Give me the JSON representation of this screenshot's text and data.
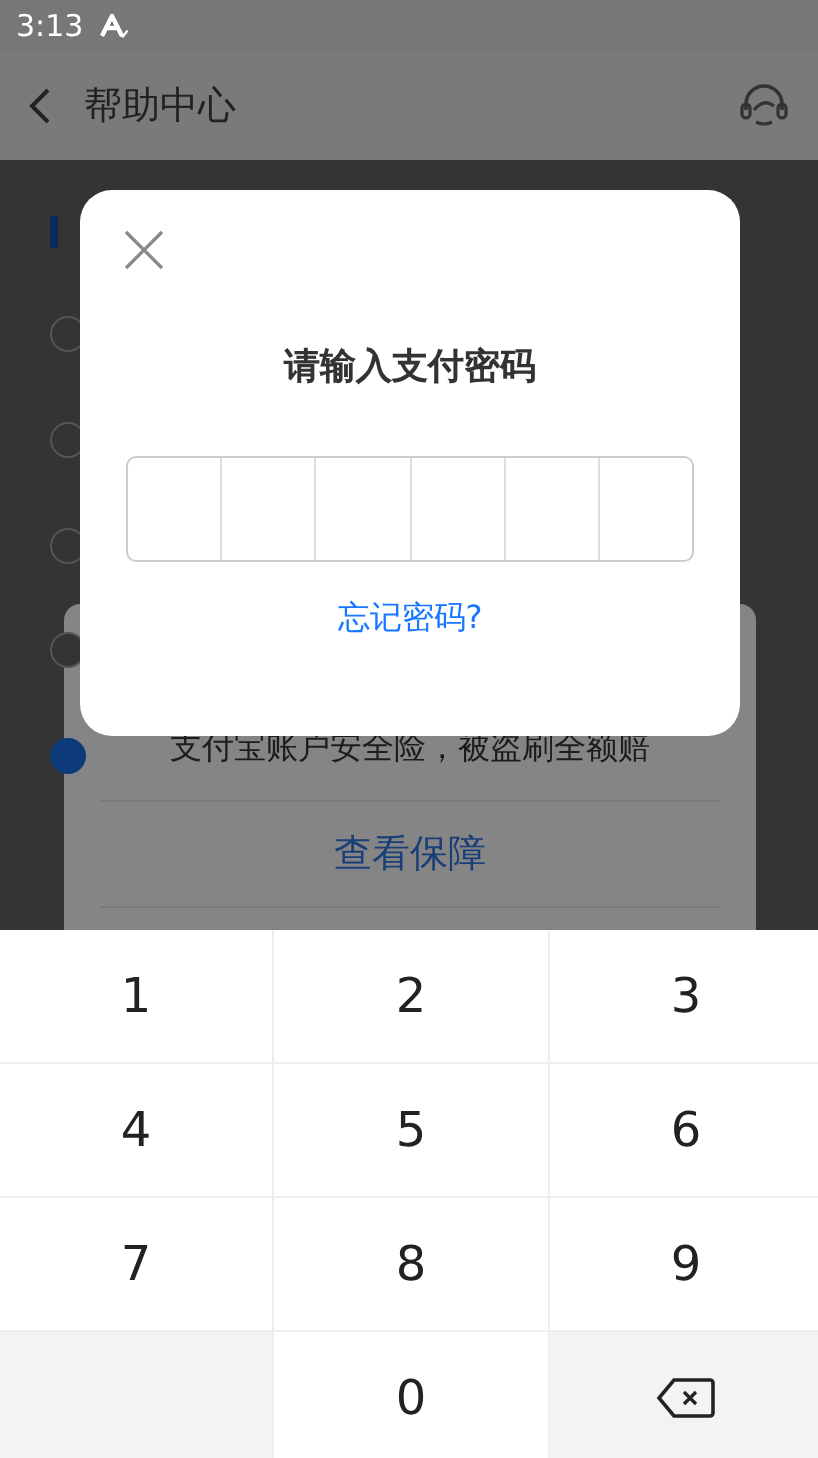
{
  "status_bar": {
    "time": "3:13"
  },
  "header": {
    "title": "帮助中心"
  },
  "background": {
    "radios": [
      {
        "selected": false
      },
      {
        "selected": false
      },
      {
        "selected": false
      },
      {
        "selected": false
      },
      {
        "selected": true
      }
    ],
    "card": {
      "text": "支付宝账户安全险，被盗刷全额赔",
      "link": "查看保障"
    }
  },
  "dialog": {
    "title": "请输入支付密码",
    "forgot_link": "忘记密码?"
  },
  "keypad": [
    {
      "kind": "digit",
      "label": "1"
    },
    {
      "kind": "digit",
      "label": "2"
    },
    {
      "kind": "digit",
      "label": "3"
    },
    {
      "kind": "digit",
      "label": "4"
    },
    {
      "kind": "digit",
      "label": "5"
    },
    {
      "kind": "digit",
      "label": "6"
    },
    {
      "kind": "digit",
      "label": "7"
    },
    {
      "kind": "digit",
      "label": "8"
    },
    {
      "kind": "digit",
      "label": "9"
    },
    {
      "kind": "blank"
    },
    {
      "kind": "digit",
      "label": "0"
    },
    {
      "kind": "backspace"
    }
  ]
}
